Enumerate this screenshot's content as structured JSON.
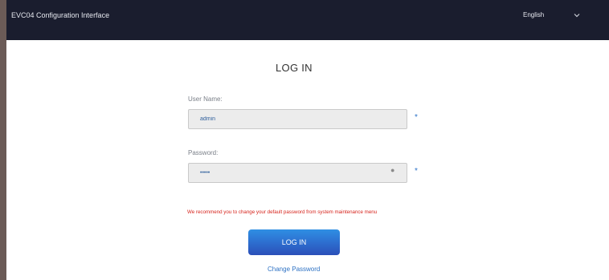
{
  "header": {
    "app_title": "EVC04 Configuration Interface",
    "language": "English"
  },
  "login": {
    "title": "LOG IN",
    "username_label": "User Name:",
    "username_value": "admin",
    "password_label": "Password:",
    "password_value": "•••••",
    "required_mark": "*",
    "warning": "We recommend you to change your default password from system maintenance menu",
    "login_button": "LOG IN",
    "change_password": "Change Password"
  },
  "colors": {
    "header_bg": "#1a1d2e",
    "accent": "#2e74c8",
    "warning": "#d6231c"
  }
}
